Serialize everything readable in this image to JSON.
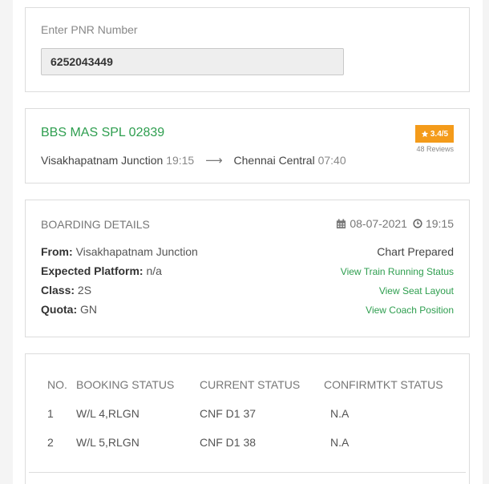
{
  "pnr": {
    "placeholder": "Enter PNR Number",
    "value": "6252043449"
  },
  "train": {
    "name": "BBS MAS SPL 02839",
    "from_station": "Visakhapatnam Junction",
    "from_time": "19:15",
    "arrow": "⟶",
    "to_station": "Chennai Central",
    "to_time": "07:40",
    "rating": "3.4/5",
    "reviews": "48 Reviews"
  },
  "boarding": {
    "heading": "BOARDING DETAILS",
    "date": "08-07-2021",
    "time": "19:15",
    "from_label": "From:",
    "from_value": "Visakhapatnam Junction",
    "platform_label": "Expected Platform:",
    "platform_value": "n/a",
    "class_label": "Class:",
    "class_value": "2S",
    "quota_label": "Quota:",
    "quota_value": "GN",
    "chart_status": "Chart Prepared",
    "link_running": "View Train Running Status",
    "link_seat": "View Seat Layout",
    "link_coach": "View Coach Position"
  },
  "booking_table": {
    "headers": [
      "NO.",
      "BOOKING STATUS",
      "CURRENT STATUS",
      "CONFIRMTKT STATUS"
    ],
    "rows": [
      [
        "1",
        "W/L 4,RLGN",
        "CNF D1 37",
        "N.A"
      ],
      [
        "2",
        "W/L 5,RLGN",
        "CNF D1 38",
        "N.A"
      ]
    ]
  },
  "colors": {
    "accent_green": "#2e9e4f",
    "rating_orange": "#f49b1a"
  },
  "icons": {
    "rating": "star-icon",
    "date": "calendar-icon",
    "time": "clock-icon",
    "route": "arrow-right-icon"
  }
}
